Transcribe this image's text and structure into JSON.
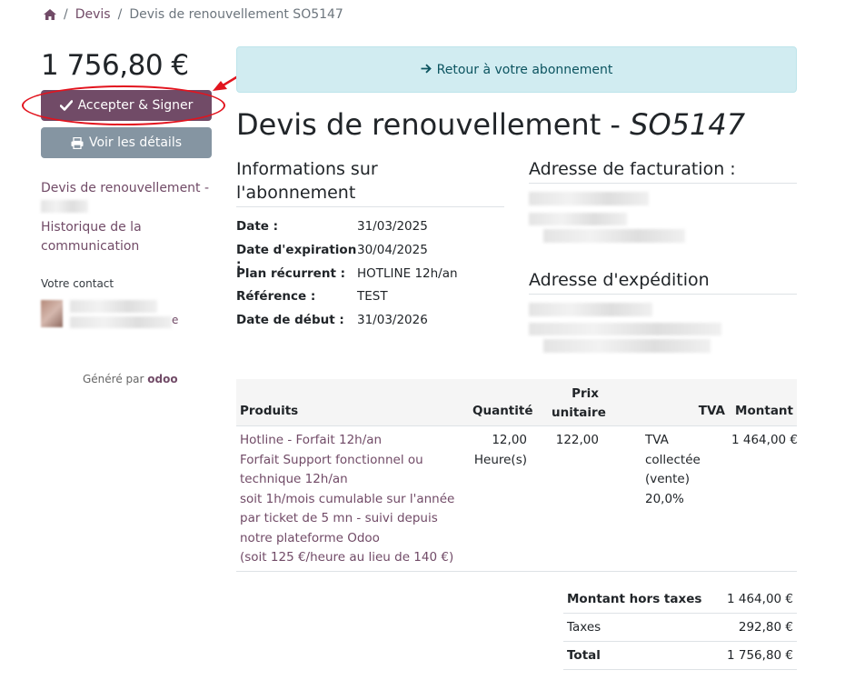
{
  "breadcrumb": {
    "home_icon": "home-icon",
    "devis": "Devis",
    "current": "Devis de renouvellement SO5147"
  },
  "sidebar": {
    "amount": "1 756,80 €",
    "accept_label": "Accepter & Signer",
    "details_label": "Voir les détails",
    "link_renewal": "Devis de renouvellement -",
    "link_history_1": "Historique de la",
    "link_history_2": "communication",
    "contact_label": "Votre contact",
    "contact_suffix": "e",
    "generated_by": "Généré par",
    "odoo": "odoo"
  },
  "main": {
    "alert_label": "Retour à votre abonnement",
    "title": "Devis de renouvellement - ",
    "title_ref": "SO5147",
    "info_title_1": "Informations sur",
    "info_title_2": "l'abonnement",
    "billing_title": "Adresse de facturation :",
    "shipping_title": "Adresse d'expédition",
    "info": [
      {
        "k": "Date :",
        "v": "31/03/2025"
      },
      {
        "k": "Date d'expiration :",
        "v": "30/04/2025"
      },
      {
        "k": "Plan récurrent :",
        "v": "HOTLINE 12h/an"
      },
      {
        "k": "Référence :",
        "v": "TEST"
      },
      {
        "k": "Date de début :",
        "v": "31/03/2026"
      }
    ]
  },
  "table": {
    "headers": {
      "product": "Produits",
      "qty": "Quantité",
      "price_1": "Prix",
      "price_2": "unitaire",
      "tax": "TVA",
      "amount": "Montant"
    },
    "row": {
      "lines": [
        "Hotline - Forfait 12h/an",
        "Forfait Support fonctionnel ou",
        "technique 12h/an",
        "soit 1h/mois cumulable sur l'année",
        "par ticket de 5 mn - suivi depuis",
        "notre plateforme Odoo",
        "(soit 125 €/heure au lieu de 140 €)"
      ],
      "qty": "12,00",
      "unit": "Heure(s)",
      "price": "122,00",
      "tax_1": "TVA collectée",
      "tax_2": "(vente) 20,0%",
      "amount": "1 464,00 €"
    }
  },
  "totals": [
    {
      "label": "Montant hors taxes",
      "value": "1 464,00 €"
    },
    {
      "label": "Taxes",
      "value": "292,80 €"
    },
    {
      "label": "Total",
      "value": "1 756,80 €"
    }
  ],
  "colors": {
    "brand": "#714b67",
    "secondary_button": "#8595a2",
    "info_alert": "#d1ecf1",
    "annotation": "#e2141e"
  }
}
